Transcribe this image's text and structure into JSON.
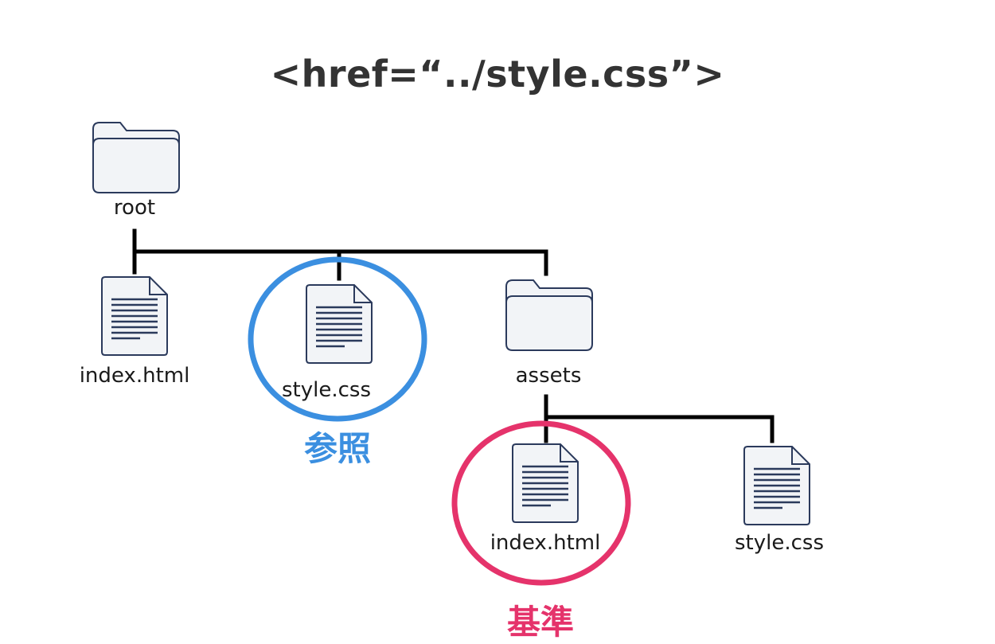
{
  "title": "<href=“../style.css”>",
  "nodes": {
    "root": {
      "label": "root",
      "type": "folder"
    },
    "root_index": {
      "label": "index.html",
      "type": "file"
    },
    "root_style": {
      "label": "style.css",
      "type": "file"
    },
    "assets": {
      "label": "assets",
      "type": "folder"
    },
    "assets_index": {
      "label": "index.html",
      "type": "file"
    },
    "assets_style": {
      "label": "style.css",
      "type": "file"
    }
  },
  "highlights": {
    "reference": {
      "label": "参照",
      "color": "#3b8fe0"
    },
    "base": {
      "label": "基準",
      "color": "#e5336b"
    }
  },
  "colors": {
    "icon_stroke": "#2b3a5c",
    "icon_fill": "#f2f4f7",
    "icon_lines": "#2b3a5c",
    "connector": "#000000",
    "title": "#333333"
  }
}
